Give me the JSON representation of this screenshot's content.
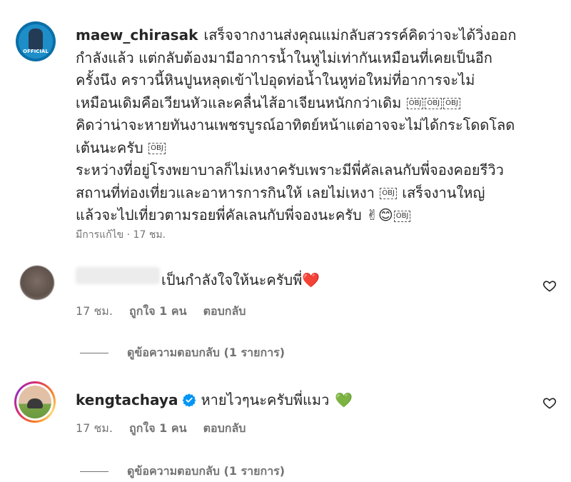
{
  "post": {
    "username": "maew_chirasak",
    "avatar_text": "OFFICIAL",
    "lines": [
      "เสร็จจากงานส่งคุณแม่กลับสวรรค์คิดว่าจะได้วิ่งออก",
      "กำลังแล้ว แต่กลับต้องมามีอาการน้ำในหูไม่เท่ากันเหมือนที่เคยเป็นอีก",
      "ครั้งนึง คราวนี้หินปูนหลุดเข้าไปอุดท่อน้ำในหูท่อใหม่ที่อาการจะไม่",
      "เหมือนเดิมคือเวียนหัวและคลื่นไส้อาเจียนหนักกว่าเดิม",
      "คิดว่าน่าจะหายทันงานเพชรบูรณ์อาทิตย์หน้าแต่อาจจะไม่ได้กระโดดโลด",
      "เต้นนะครับ",
      "ระหว่างที่อยู่โรงพยาบาลก็ไม่เหงาครับเพราะมีพี่คัลเลนกับพี่จองคอยรีวิว",
      "สถานที่ท่องเที่ยวและอาหารการกินให้ เลยไม่เหงา",
      "เสร็จงานใหญ่",
      "แล้วจะไปเที่ยวตามรอยพี่คัลเลนกับพี่จองนะครับ"
    ],
    "obj_label": "OBJ",
    "emoji": "✌😊",
    "edited": "มีการแก้ไข · 17 ชม."
  },
  "comments": [
    {
      "text": "เป็นกำลังใจให้นะครับพี่",
      "emoji": "❤️",
      "time": "17 ชม.",
      "likes": "ถูกใจ 1 คน",
      "reply": "ตอบกลับ",
      "view_replies": "ดูข้อความตอบกลับ (1 รายการ)"
    },
    {
      "username": "kengtachaya",
      "text": "หายไวๆนะครับพี่แมว",
      "emoji": "💚",
      "time": "17 ชม.",
      "likes": "ถูกใจ 1 คน",
      "reply": "ตอบกลับ",
      "view_replies": "ดูข้อความตอบกลับ (1 รายการ)"
    }
  ],
  "colors": {
    "verified": "#0095f6",
    "heart": "#ed4956",
    "green_heart": "#2ecc40"
  }
}
